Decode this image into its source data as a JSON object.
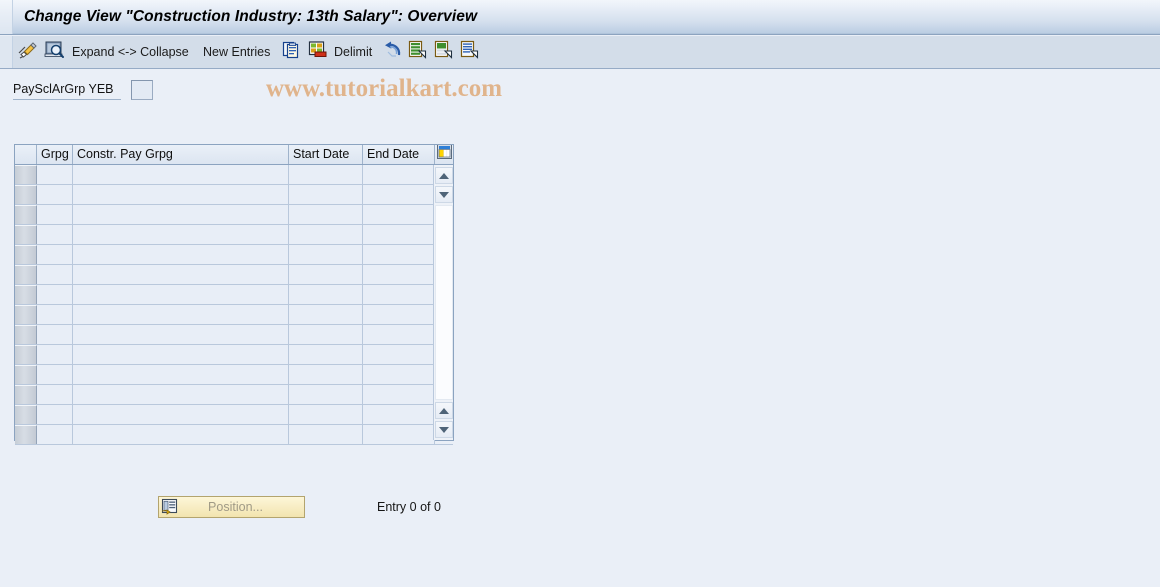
{
  "window": {
    "title": "Change View \"Construction Industry: 13th Salary\": Overview"
  },
  "watermark": {
    "text": "www.tutorialkart.com",
    "color": "#d67e2b"
  },
  "toolbar": {
    "items": [
      {
        "name": "change-pencil-icon",
        "icon": "pencil-icon",
        "label": ""
      },
      {
        "name": "display-magnifier-icon",
        "icon": "magnifier-icon",
        "label": ""
      },
      {
        "name": "expand-collapse-button",
        "icon": "",
        "label": "Expand <-> Collapse"
      },
      {
        "name": "new-entries-button",
        "icon": "",
        "label": "New Entries"
      },
      {
        "name": "copy-as-icon",
        "icon": "copy-icon",
        "label": ""
      },
      {
        "name": "delete-icon",
        "icon": "delete-icon",
        "label": ""
      },
      {
        "name": "delimit-button",
        "icon": "",
        "label": "Delimit"
      },
      {
        "name": "undo-icon",
        "icon": "undo-icon",
        "label": ""
      },
      {
        "name": "select-all-icon",
        "icon": "select-all-icon",
        "label": ""
      },
      {
        "name": "deselect-all-icon",
        "icon": "deselect-all-icon",
        "label": ""
      },
      {
        "name": "select-block-icon",
        "icon": "select-block-icon",
        "label": ""
      }
    ]
  },
  "form": {
    "payscale_label": "PaySclArGrp YEB",
    "payscale_value": "",
    "payscale_placeholder": ""
  },
  "table": {
    "columns": [
      {
        "key": "sel",
        "label": ""
      },
      {
        "key": "grpg",
        "label": "Grpg"
      },
      {
        "key": "cpg",
        "label": "Constr. Pay Grpg"
      },
      {
        "key": "sd",
        "label": "Start Date"
      },
      {
        "key": "ed",
        "label": "End Date"
      }
    ],
    "settings_icon": "table-settings-icon",
    "rows": [
      {
        "grpg": "",
        "cpg": "",
        "sd": "",
        "ed": ""
      },
      {
        "grpg": "",
        "cpg": "",
        "sd": "",
        "ed": ""
      },
      {
        "grpg": "",
        "cpg": "",
        "sd": "",
        "ed": ""
      },
      {
        "grpg": "",
        "cpg": "",
        "sd": "",
        "ed": ""
      },
      {
        "grpg": "",
        "cpg": "",
        "sd": "",
        "ed": ""
      },
      {
        "grpg": "",
        "cpg": "",
        "sd": "",
        "ed": ""
      },
      {
        "grpg": "",
        "cpg": "",
        "sd": "",
        "ed": ""
      },
      {
        "grpg": "",
        "cpg": "",
        "sd": "",
        "ed": ""
      },
      {
        "grpg": "",
        "cpg": "",
        "sd": "",
        "ed": ""
      },
      {
        "grpg": "",
        "cpg": "",
        "sd": "",
        "ed": ""
      },
      {
        "grpg": "",
        "cpg": "",
        "sd": "",
        "ed": ""
      },
      {
        "grpg": "",
        "cpg": "",
        "sd": "",
        "ed": ""
      },
      {
        "grpg": "",
        "cpg": "",
        "sd": "",
        "ed": ""
      },
      {
        "grpg": "",
        "cpg": "",
        "sd": "",
        "ed": ""
      }
    ]
  },
  "footer": {
    "position_label": "Position...",
    "position_icon": "position-icon",
    "entry_status": "Entry 0 of 0"
  }
}
